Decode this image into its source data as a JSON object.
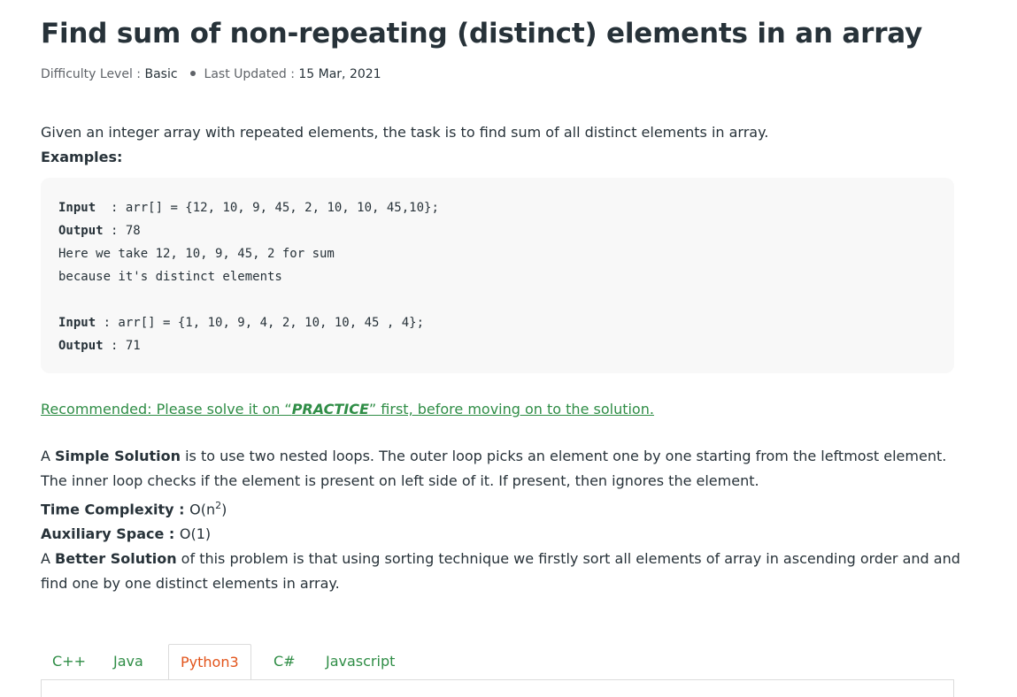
{
  "article": {
    "title": "Find sum of non-repeating (distinct) elements in an array",
    "meta": {
      "difficulty_label": "Difficulty Level : ",
      "difficulty_value": "Basic",
      "updated_label": "Last Updated : ",
      "updated_value": "15 Mar, 2021"
    },
    "intro": "Given an integer array with repeated elements, the task is to find sum of all distinct elements in array.",
    "examples_label": "Examples:",
    "code_lines": [
      {
        "kw": "Input  ",
        "rest": ": arr[] = {12, 10, 9, 45, 2, 10, 10, 45,10};"
      },
      {
        "kw": "Output ",
        "rest": ": 78"
      },
      {
        "kw": "",
        "rest": "Here we take 12, 10, 9, 45, 2 for sum"
      },
      {
        "kw": "",
        "rest": "because it's distinct elements"
      },
      {
        "kw": "",
        "rest": ""
      },
      {
        "kw": "Input ",
        "rest": ": arr[] = {1, 10, 9, 4, 2, 10, 10, 45 , 4};"
      },
      {
        "kw": "Output ",
        "rest": ": 71"
      }
    ],
    "recommend": {
      "before": "Recommended: Please solve it on “",
      "practice": "PRACTICE",
      "after": "” first, before moving on to the solution."
    },
    "simple": {
      "a": "A ",
      "bold": "Simple Solution",
      "rest": " is to use two nested loops. The outer loop picks an element one by one starting from the leftmost element. The inner loop checks if the element is present on left side of it. If present, then ignores the element."
    },
    "time": {
      "label": "Time Complexity : ",
      "value": "O(n",
      "sup": "2",
      "close": ")"
    },
    "aux": {
      "label": "Auxiliary Space : ",
      "value": "O(1)"
    },
    "better": {
      "a": "A ",
      "bold": "Better Solution",
      "rest": " of this problem is that using sorting technique we firstly sort all elements of array in ascending order and and find one by one distinct elements in array."
    }
  },
  "tabs": [
    {
      "label": "C++",
      "active": false
    },
    {
      "label": "Java",
      "active": false
    },
    {
      "label": "Python3",
      "active": true
    },
    {
      "label": "C#",
      "active": false
    },
    {
      "label": "Javascript",
      "active": false
    }
  ],
  "colors": {
    "accent_green": "#2f8d46",
    "active_tab": "#e2541b",
    "text": "#273239"
  }
}
